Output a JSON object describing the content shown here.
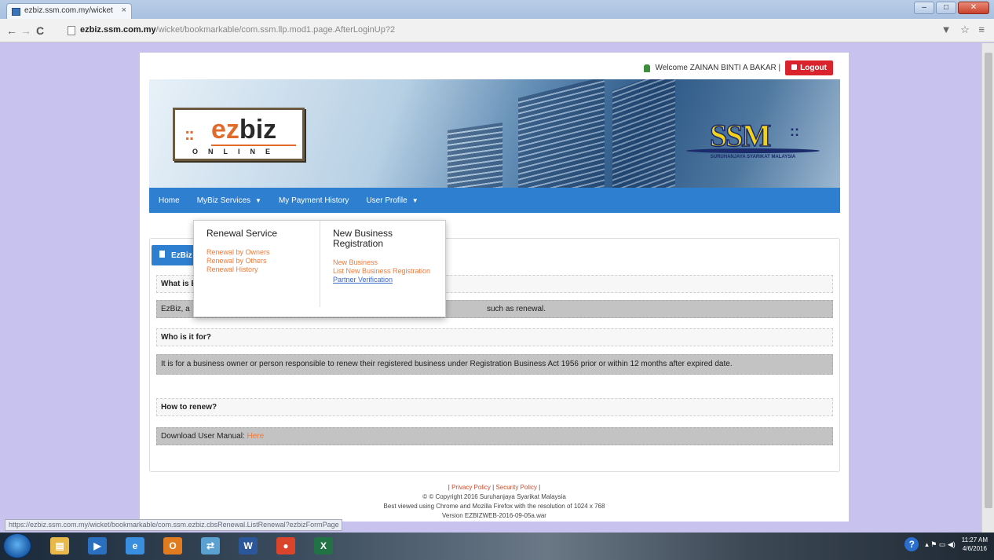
{
  "browser": {
    "tab_title": "ezbiz.ssm.com.my/wicket",
    "tab_close": "×",
    "url_host": "ezbiz.ssm.com.my",
    "url_path": "/wicket/bookmarkable/com.ssm.llp.mod1.page.AfterLoginUp?2",
    "back": "←",
    "forward": "→",
    "reload": "C",
    "minimize": "–",
    "maximize": "□",
    "close": "✕",
    "toolbar_icons": "▼ ☆ ≡",
    "status_url": "https://ezbiz.ssm.com.my/wicket/bookmarkable/com.ssm.ezbiz.cbsRenewal.ListRenewal?ezbizFormPage"
  },
  "header": {
    "welcome": "Welcome ZAINAN BINTI A BAKAR |",
    "logout": "Logout"
  },
  "logo": {
    "dots": "::",
    "ez": "ez",
    "biz": "biz",
    "online": "ONLINE",
    "ssm": "SSM",
    "ssm_dots": "::",
    "ssm_sub": "SURUHANJAYA SYARIKAT MALAYSIA"
  },
  "nav": {
    "home": "Home",
    "services": "MyBiz Services",
    "payment": "My Payment History",
    "profile": "User Profile"
  },
  "dropdown": {
    "col1_title": "Renewal Service",
    "col1_links": [
      "Renewal by Owners",
      "Renewal by Others",
      "Renewal History"
    ],
    "col2_title": "New Business Registration",
    "col2_links": [
      "New Business",
      "List New Business Registration",
      "Partner Verification"
    ]
  },
  "panel": {
    "head": "EzBiz",
    "q1": "What is EzBiz?",
    "a1_start": "EzBiz, a",
    "a1_end": "such as renewal.",
    "q2": "Who is it for?",
    "a2": "It is for a business owner or person responsible to renew their registered business under Registration Business Act 1956 prior or within 12 months after expired date.",
    "q3": "How to renew?",
    "a3_text": "Download User Manual:",
    "a3_link": "Here"
  },
  "footer": {
    "sep_open": "|",
    "privacy": "Privacy Policy",
    "sep_mid": "|",
    "security": "Security Policy",
    "sep_close": "|",
    "copyright": "© © Copyright 2016 Suruhanjaya Syarikat Malaysia",
    "best_view": "Best viewed using Chrome and Mozilla Firefox with the resolution of 1024 x 768",
    "version": "Version EZBIZWEB-2016-09-05a.war"
  },
  "taskbar": {
    "apps": [
      {
        "name": "explorer",
        "glyph": "▤",
        "color": "#e8b84a"
      },
      {
        "name": "media",
        "glyph": "▶",
        "color": "#2a6fc0"
      },
      {
        "name": "ie",
        "glyph": "e",
        "color": "#3a8ee0"
      },
      {
        "name": "outlook",
        "glyph": "O",
        "color": "#e07b20"
      },
      {
        "name": "network",
        "glyph": "⇄",
        "color": "#5aa0d0"
      },
      {
        "name": "word",
        "glyph": "W",
        "color": "#2b579a"
      },
      {
        "name": "chrome",
        "glyph": "●",
        "color": "#d9442b"
      },
      {
        "name": "excel",
        "glyph": "X",
        "color": "#217346"
      }
    ],
    "help": "?",
    "tray_icons": "▴ ⚑ ▭ ◀)",
    "time": "11:27 AM",
    "date": "4/6/2016"
  },
  "colors": {
    "accent": "#2f7fd0",
    "logout": "#d9232d",
    "link_orange": "#f07a3a",
    "page_bg": "#c7c3ee"
  }
}
